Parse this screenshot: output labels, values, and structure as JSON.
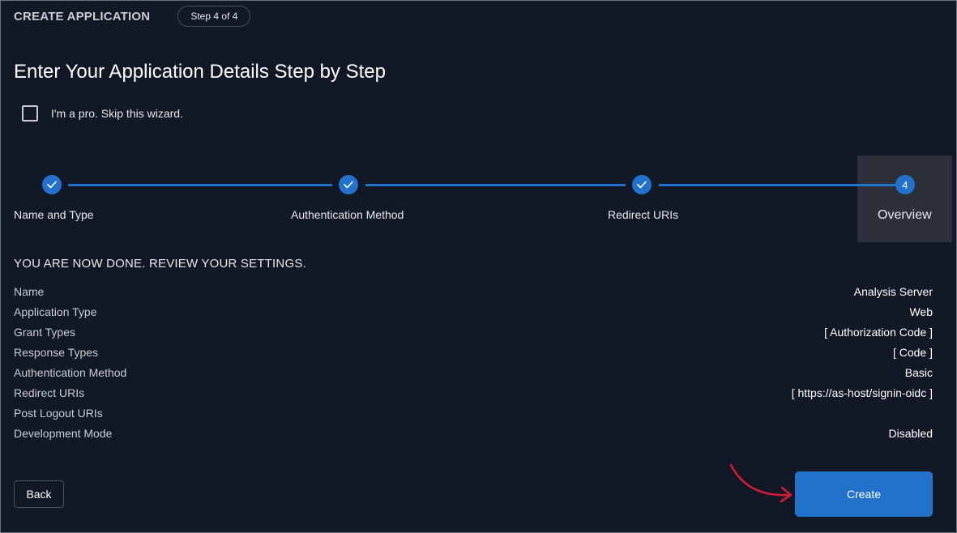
{
  "header": {
    "title": "CREATE APPLICATION",
    "step_badge": "Step 4 of 4"
  },
  "page_title": "Enter Your Application Details Step by Step",
  "skip_wizard": {
    "label": "I'm a pro. Skip this wizard.",
    "checked": false
  },
  "stepper": {
    "accent_color": "#2272cc",
    "steps": [
      {
        "label": "Name and Type",
        "state": "completed",
        "icon": "check-icon"
      },
      {
        "label": "Authentication Method",
        "state": "completed",
        "icon": "check-icon"
      },
      {
        "label": "Redirect URIs",
        "state": "completed",
        "icon": "check-icon"
      },
      {
        "label": "Overview",
        "state": "active",
        "number": "4"
      }
    ]
  },
  "review": {
    "title": "YOU ARE NOW DONE. REVIEW YOUR SETTINGS.",
    "rows": [
      {
        "key": "Name",
        "value": "Analysis Server"
      },
      {
        "key": "Application Type",
        "value": "Web"
      },
      {
        "key": "Grant Types",
        "value": "[ Authorization Code ]"
      },
      {
        "key": "Response Types",
        "value": "[ Code ]"
      },
      {
        "key": "Authentication Method",
        "value": "Basic"
      },
      {
        "key": "Redirect URIs",
        "value": "[ https://as-host/signin-oidc ]"
      },
      {
        "key": "Post Logout URIs",
        "value": ""
      },
      {
        "key": "Development Mode",
        "value": "Disabled"
      }
    ]
  },
  "actions": {
    "back_label": "Back",
    "create_label": "Create",
    "annotation_color": "#d01c35"
  }
}
